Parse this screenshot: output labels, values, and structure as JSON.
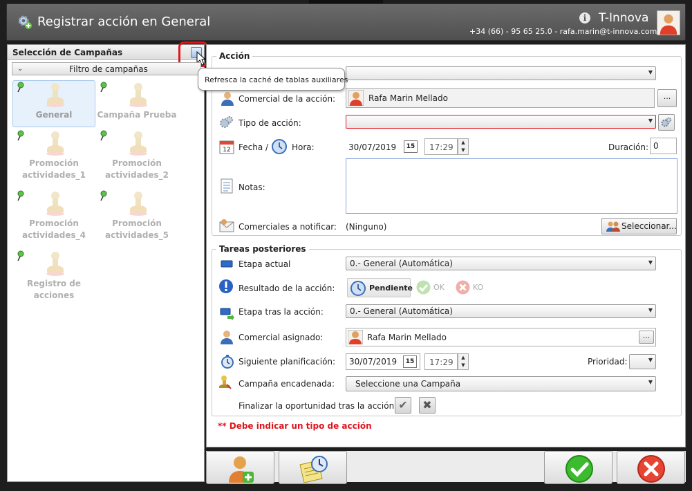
{
  "window": {
    "title": "Registrar acción en General",
    "company": "T-Innova",
    "contact": "+34 (66)  - 95 65 25.0 - rafa.marin@t-innova.com"
  },
  "left_panel": {
    "title": "Selección de Campañas",
    "filter_label": "Filtro de campañas",
    "tooltip": "Refresca la caché de tablas auxiliares",
    "campaigns": [
      {
        "label": "General"
      },
      {
        "label": "Campaña Prueba"
      },
      {
        "label": "Promoción actividades_1"
      },
      {
        "label": "Promoción actividades_2"
      },
      {
        "label": "Promoción actividades_4"
      },
      {
        "label": "Promoción actividades_5"
      },
      {
        "label": "Registro de acciones"
      }
    ]
  },
  "accion": {
    "group_title": "Acción",
    "comercial_label": "Comercial de la acción:",
    "comercial_value": "Rafa Marin Mellado",
    "tipo_label": "Tipo de acción:",
    "fecha_label": "Fecha /",
    "hora_label": "Hora:",
    "fecha_value": "30/07/2019",
    "hora_value": "17:29",
    "duracion_label": "Duración:",
    "duracion_value": "0",
    "notas_label": "Notas:",
    "notificar_label": "Comerciales a notificar:",
    "notificar_value": "(Ninguno)",
    "seleccionar_label": "Seleccionar...",
    "ellipsis": "...",
    "calendar_day": "15"
  },
  "tareas": {
    "group_title": "Tareas posteriores",
    "etapa_actual_label": "Etapa actual",
    "etapa_actual_value": "0.- General (Automática)",
    "resultado_label": "Resultado de la acción:",
    "pendiente_label": "Pendiente",
    "ok_label": "OK",
    "ko_label": "KO",
    "etapa_tras_label": "Etapa tras la acción:",
    "etapa_tras_value": "0.- General (Automática)",
    "comercial_asignado_label": "Comercial asignado:",
    "comercial_asignado_value": "Rafa Marin Mellado",
    "siguiente_label": "Siguiente planificación:",
    "siguiente_fecha": "30/07/2019",
    "siguiente_hora": "17:29",
    "prioridad_label": "Prioridad:",
    "campana_label": "Campaña encadenada:",
    "campana_value": "Seleccione una Campaña",
    "finalizar_label": "Finalizar la oportunidad tras la acción:"
  },
  "error_message": "** Debe indicar un tipo de acción",
  "colors": {
    "error": "#e0141c",
    "title_bar": "#5a5a5a",
    "accent": "#3a74c4"
  }
}
